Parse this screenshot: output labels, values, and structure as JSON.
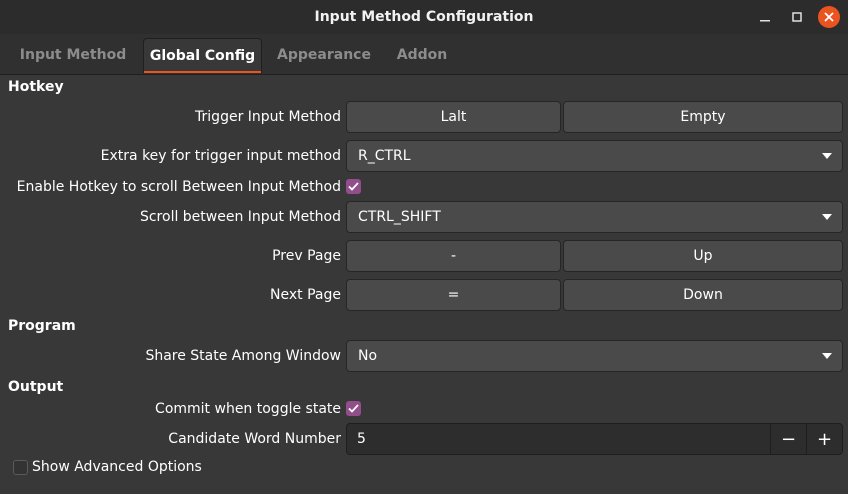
{
  "window": {
    "title": "Input Method Configuration"
  },
  "tabs": [
    {
      "label": "Input Method",
      "active": false
    },
    {
      "label": "Global Config",
      "active": true
    },
    {
      "label": "Appearance",
      "active": false
    },
    {
      "label": "Addon",
      "active": false
    }
  ],
  "hotkey": {
    "section_title": "Hotkey",
    "trigger": {
      "label": "Trigger Input Method",
      "key1": "Lalt",
      "key2": "Empty"
    },
    "extra_key": {
      "label": "Extra key for trigger input method",
      "value": "R_CTRL"
    },
    "enable_scroll": {
      "label": "Enable Hotkey to scroll Between Input Method",
      "checked": true
    },
    "scroll": {
      "label": "Scroll between Input Method",
      "value": "CTRL_SHIFT"
    },
    "prev_page": {
      "label": "Prev Page",
      "key1": "-",
      "key2": "Up"
    },
    "next_page": {
      "label": "Next Page",
      "key1": "=",
      "key2": "Down"
    }
  },
  "program": {
    "section_title": "Program",
    "share_state": {
      "label": "Share State Among Window",
      "value": "No"
    }
  },
  "output": {
    "section_title": "Output",
    "commit_toggle": {
      "label": "Commit when toggle state",
      "checked": true
    },
    "candidate_number": {
      "label": "Candidate Word Number",
      "value": "5",
      "minus": "−",
      "plus": "+"
    }
  },
  "advanced": {
    "label": "Show Advanced Options",
    "checked": false
  },
  "colors": {
    "accent": "#e95420",
    "check": "#924d8b",
    "background": "#383838"
  }
}
